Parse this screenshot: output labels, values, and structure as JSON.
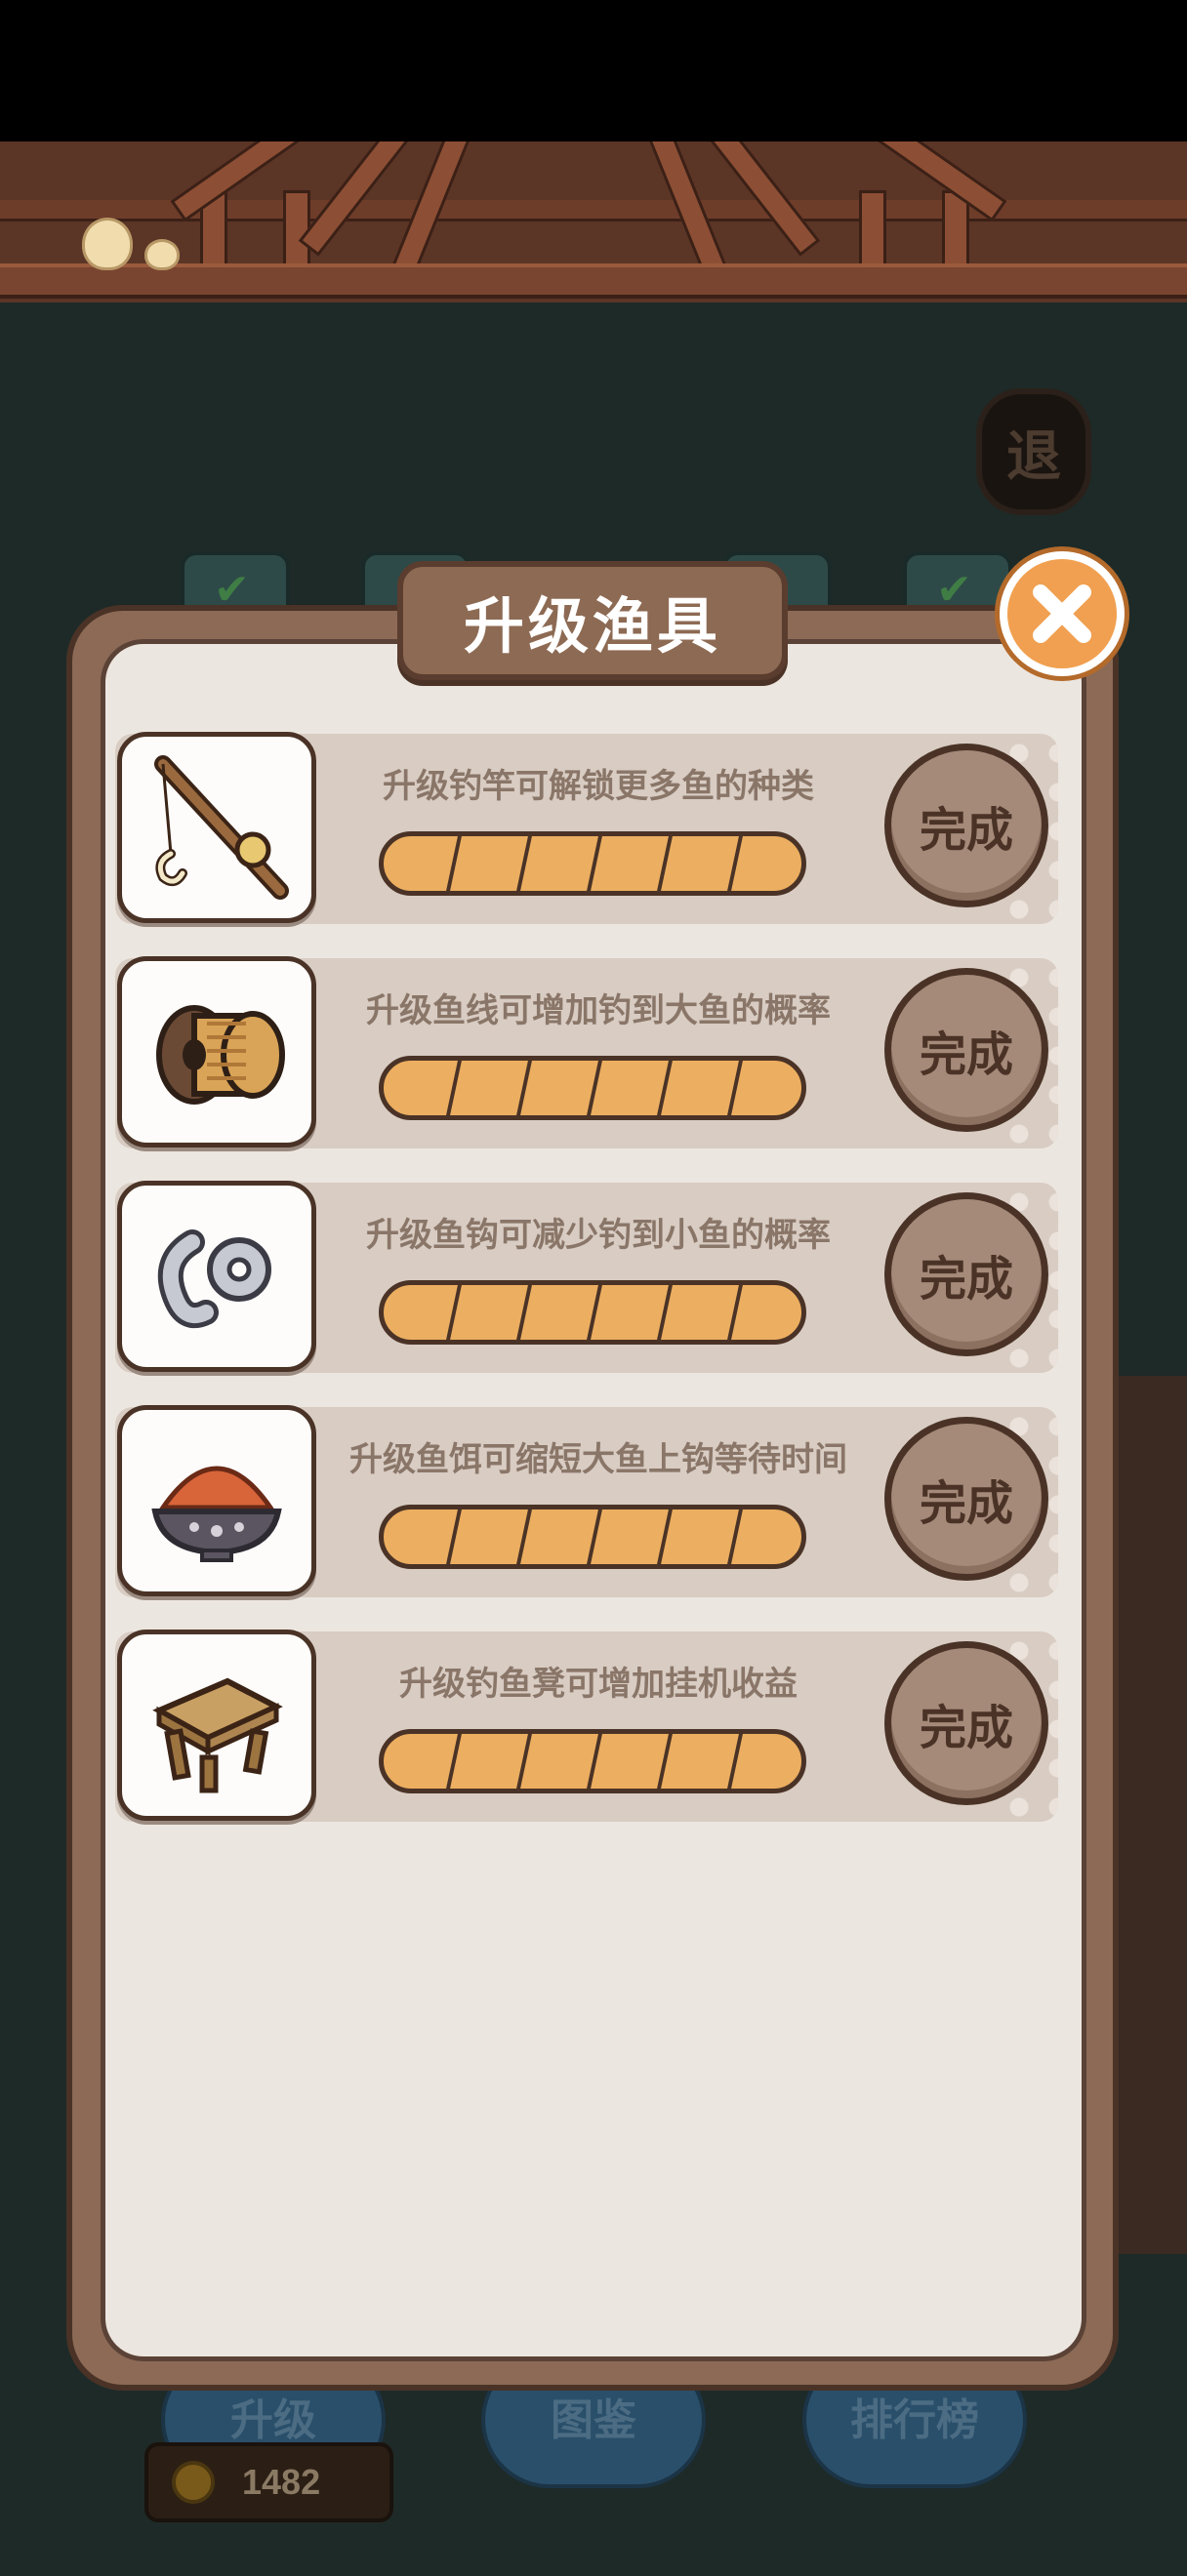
{
  "background": {
    "exit_button_label": "退",
    "bottom_buttons": [
      "升级",
      "图鉴",
      "排行榜"
    ],
    "coin_count": "1482"
  },
  "modal": {
    "title": "升级渔具",
    "close_icon": "close-icon",
    "items": [
      {
        "icon": "fishing-rod-icon",
        "description": "升级钓竿可解锁更多鱼的种类",
        "progress": 1.0,
        "segments": 6,
        "button_label": "完成"
      },
      {
        "icon": "fishing-line-spool-icon",
        "description": "升级鱼线可增加钓到大鱼的概率",
        "progress": 1.0,
        "segments": 6,
        "button_label": "完成"
      },
      {
        "icon": "fish-hook-icon",
        "description": "升级鱼钩可减少钓到小鱼的概率",
        "progress": 1.0,
        "segments": 6,
        "button_label": "完成"
      },
      {
        "icon": "fish-bait-bowl-icon",
        "description": "升级鱼饵可缩短大鱼上钩等待时间",
        "progress": 1.0,
        "segments": 6,
        "button_label": "完成"
      },
      {
        "icon": "fishing-stool-icon",
        "description": "升级钓鱼凳可增加挂机收益",
        "progress": 1.0,
        "segments": 6,
        "button_label": "完成"
      }
    ]
  },
  "colors": {
    "panel_bg": "#ece6e0",
    "panel_border": "#4a3326",
    "progress_fill": "#ecae60",
    "close_button": "#f0a050"
  }
}
